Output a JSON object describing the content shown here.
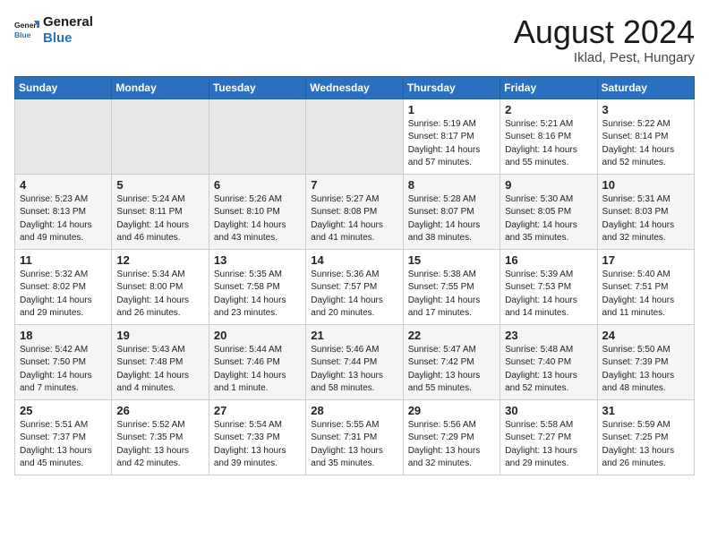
{
  "header": {
    "logo_general": "General",
    "logo_blue": "Blue",
    "month_title": "August 2024",
    "location": "Iklad, Pest, Hungary"
  },
  "weekdays": [
    "Sunday",
    "Monday",
    "Tuesday",
    "Wednesday",
    "Thursday",
    "Friday",
    "Saturday"
  ],
  "weeks": [
    [
      {
        "day": "",
        "info": ""
      },
      {
        "day": "",
        "info": ""
      },
      {
        "day": "",
        "info": ""
      },
      {
        "day": "",
        "info": ""
      },
      {
        "day": "1",
        "info": "Sunrise: 5:19 AM\nSunset: 8:17 PM\nDaylight: 14 hours\nand 57 minutes."
      },
      {
        "day": "2",
        "info": "Sunrise: 5:21 AM\nSunset: 8:16 PM\nDaylight: 14 hours\nand 55 minutes."
      },
      {
        "day": "3",
        "info": "Sunrise: 5:22 AM\nSunset: 8:14 PM\nDaylight: 14 hours\nand 52 minutes."
      }
    ],
    [
      {
        "day": "4",
        "info": "Sunrise: 5:23 AM\nSunset: 8:13 PM\nDaylight: 14 hours\nand 49 minutes."
      },
      {
        "day": "5",
        "info": "Sunrise: 5:24 AM\nSunset: 8:11 PM\nDaylight: 14 hours\nand 46 minutes."
      },
      {
        "day": "6",
        "info": "Sunrise: 5:26 AM\nSunset: 8:10 PM\nDaylight: 14 hours\nand 43 minutes."
      },
      {
        "day": "7",
        "info": "Sunrise: 5:27 AM\nSunset: 8:08 PM\nDaylight: 14 hours\nand 41 minutes."
      },
      {
        "day": "8",
        "info": "Sunrise: 5:28 AM\nSunset: 8:07 PM\nDaylight: 14 hours\nand 38 minutes."
      },
      {
        "day": "9",
        "info": "Sunrise: 5:30 AM\nSunset: 8:05 PM\nDaylight: 14 hours\nand 35 minutes."
      },
      {
        "day": "10",
        "info": "Sunrise: 5:31 AM\nSunset: 8:03 PM\nDaylight: 14 hours\nand 32 minutes."
      }
    ],
    [
      {
        "day": "11",
        "info": "Sunrise: 5:32 AM\nSunset: 8:02 PM\nDaylight: 14 hours\nand 29 minutes."
      },
      {
        "day": "12",
        "info": "Sunrise: 5:34 AM\nSunset: 8:00 PM\nDaylight: 14 hours\nand 26 minutes."
      },
      {
        "day": "13",
        "info": "Sunrise: 5:35 AM\nSunset: 7:58 PM\nDaylight: 14 hours\nand 23 minutes."
      },
      {
        "day": "14",
        "info": "Sunrise: 5:36 AM\nSunset: 7:57 PM\nDaylight: 14 hours\nand 20 minutes."
      },
      {
        "day": "15",
        "info": "Sunrise: 5:38 AM\nSunset: 7:55 PM\nDaylight: 14 hours\nand 17 minutes."
      },
      {
        "day": "16",
        "info": "Sunrise: 5:39 AM\nSunset: 7:53 PM\nDaylight: 14 hours\nand 14 minutes."
      },
      {
        "day": "17",
        "info": "Sunrise: 5:40 AM\nSunset: 7:51 PM\nDaylight: 14 hours\nand 11 minutes."
      }
    ],
    [
      {
        "day": "18",
        "info": "Sunrise: 5:42 AM\nSunset: 7:50 PM\nDaylight: 14 hours\nand 7 minutes."
      },
      {
        "day": "19",
        "info": "Sunrise: 5:43 AM\nSunset: 7:48 PM\nDaylight: 14 hours\nand 4 minutes."
      },
      {
        "day": "20",
        "info": "Sunrise: 5:44 AM\nSunset: 7:46 PM\nDaylight: 14 hours\nand 1 minute."
      },
      {
        "day": "21",
        "info": "Sunrise: 5:46 AM\nSunset: 7:44 PM\nDaylight: 13 hours\nand 58 minutes."
      },
      {
        "day": "22",
        "info": "Sunrise: 5:47 AM\nSunset: 7:42 PM\nDaylight: 13 hours\nand 55 minutes."
      },
      {
        "day": "23",
        "info": "Sunrise: 5:48 AM\nSunset: 7:40 PM\nDaylight: 13 hours\nand 52 minutes."
      },
      {
        "day": "24",
        "info": "Sunrise: 5:50 AM\nSunset: 7:39 PM\nDaylight: 13 hours\nand 48 minutes."
      }
    ],
    [
      {
        "day": "25",
        "info": "Sunrise: 5:51 AM\nSunset: 7:37 PM\nDaylight: 13 hours\nand 45 minutes."
      },
      {
        "day": "26",
        "info": "Sunrise: 5:52 AM\nSunset: 7:35 PM\nDaylight: 13 hours\nand 42 minutes."
      },
      {
        "day": "27",
        "info": "Sunrise: 5:54 AM\nSunset: 7:33 PM\nDaylight: 13 hours\nand 39 minutes."
      },
      {
        "day": "28",
        "info": "Sunrise: 5:55 AM\nSunset: 7:31 PM\nDaylight: 13 hours\nand 35 minutes."
      },
      {
        "day": "29",
        "info": "Sunrise: 5:56 AM\nSunset: 7:29 PM\nDaylight: 13 hours\nand 32 minutes."
      },
      {
        "day": "30",
        "info": "Sunrise: 5:58 AM\nSunset: 7:27 PM\nDaylight: 13 hours\nand 29 minutes."
      },
      {
        "day": "31",
        "info": "Sunrise: 5:59 AM\nSunset: 7:25 PM\nDaylight: 13 hours\nand 26 minutes."
      }
    ]
  ]
}
